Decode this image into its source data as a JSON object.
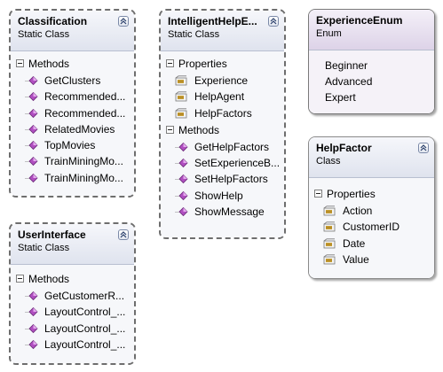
{
  "classes": {
    "classification": {
      "name": "Classification",
      "stereotype": "Static Class",
      "methods_label": "Methods",
      "methods": [
        "GetClusters",
        "Recommended...",
        "Recommended...",
        "RelatedMovies",
        "TopMovies",
        "TrainMiningMo...",
        "TrainMiningMo..."
      ]
    },
    "intelligent_help": {
      "name": "IntelligentHelpE...",
      "stereotype": "Static Class",
      "properties_label": "Properties",
      "properties": [
        "Experience",
        "HelpAgent",
        "HelpFactors"
      ],
      "methods_label": "Methods",
      "methods": [
        "GetHelpFactors",
        "SetExperienceB...",
        "SetHelpFactors",
        "ShowHelp",
        "ShowMessage"
      ]
    },
    "experience_enum": {
      "name": "ExperienceEnum",
      "stereotype": "Enum",
      "values": [
        "Beginner",
        "Advanced",
        "Expert"
      ]
    },
    "help_factor": {
      "name": "HelpFactor",
      "stereotype": "Class",
      "properties_label": "Properties",
      "properties": [
        "Action",
        "CustomerID",
        "Date",
        "Value"
      ]
    },
    "user_interface": {
      "name": "UserInterface",
      "stereotype": "Static Class",
      "methods_label": "Methods",
      "methods": [
        "GetCustomerR...",
        "LayoutControl_...",
        "LayoutControl_...",
        "LayoutControl_..."
      ]
    }
  },
  "icons": {
    "method": "method-icon",
    "property": "property-icon",
    "collapse": "chevron-up-icon"
  },
  "colors": {
    "method_icon": "#b04fc0",
    "property_icon": "#c8a034",
    "header_top": "#f6f7fb",
    "header_bottom": "#dfe3ee"
  }
}
